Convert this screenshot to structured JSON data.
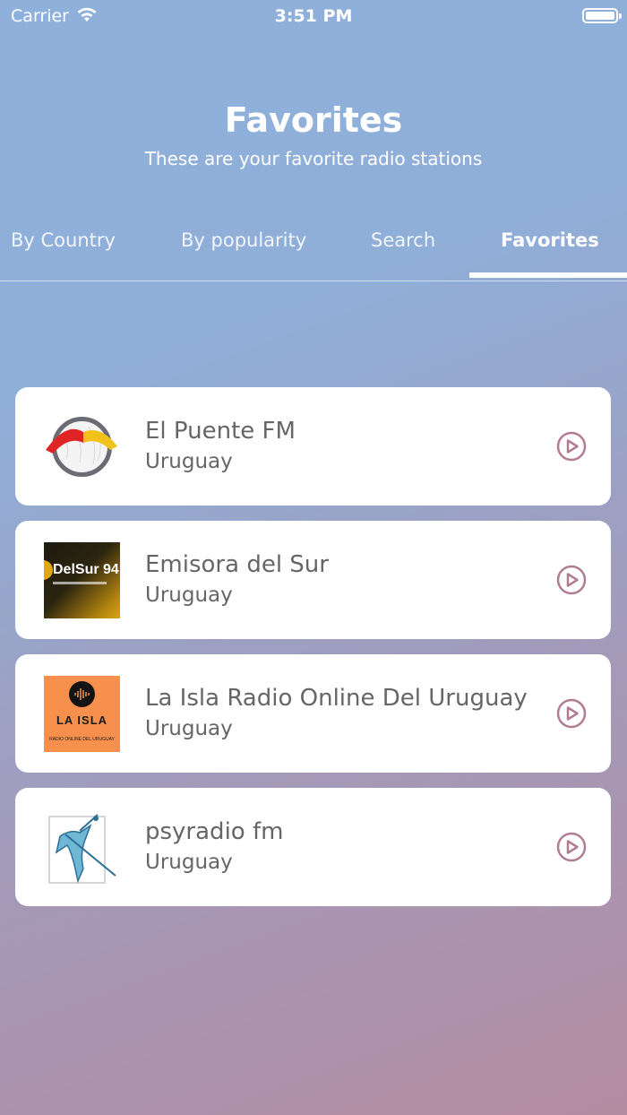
{
  "status_bar": {
    "carrier": "Carrier",
    "time": "3:51 PM"
  },
  "header": {
    "title": "Favorites",
    "subtitle": "These are your favorite radio stations"
  },
  "tabs": [
    {
      "label": "By Country",
      "active": false
    },
    {
      "label": "By popularity",
      "active": false
    },
    {
      "label": "Search",
      "active": false
    },
    {
      "label": "Favorites",
      "active": true
    }
  ],
  "stations": [
    {
      "name": "El Puente FM",
      "country": "Uruguay",
      "logo_icon": "el-puente-logo"
    },
    {
      "name": "Emisora del Sur",
      "country": "Uruguay",
      "logo_icon": "delsur-logo",
      "logo_text": "DelSur 94."
    },
    {
      "name": "La Isla Radio Online Del Uruguay",
      "country": "Uruguay",
      "logo_icon": "la-isla-logo",
      "logo_text": "LA ISLA",
      "logo_subtext": "RADIO ONLINE DEL URUGUAY"
    },
    {
      "name": "psyradio fm",
      "country": "Uruguay",
      "logo_icon": "psyradio-logo"
    }
  ],
  "colors": {
    "play_icon": "#b07d92",
    "card_text": "#666666",
    "la_isla_bg": "#f7904d",
    "delsur_accent": "#e0a80f"
  }
}
